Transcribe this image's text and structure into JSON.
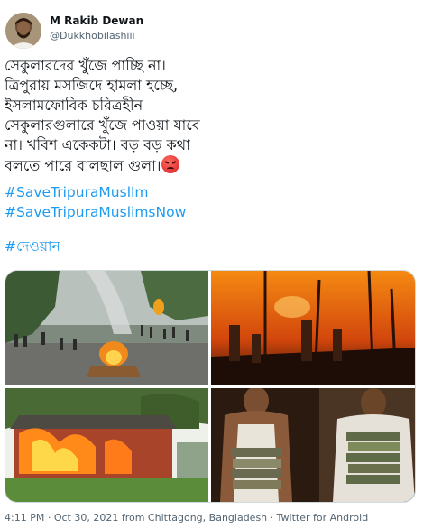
{
  "author": {
    "name": "M Rakib Dewan",
    "handle": "@Dukkhobilashiii"
  },
  "tweet": {
    "lines": [
      "সেকুলারদের খুঁজে পাচ্ছি না।",
      "ত্রিপুরায় মসজিদে হামলা হচ্ছে,",
      "ইসলামফোবিক চরিত্রহীন",
      "সেকুলারগুলারে খুঁজে পাওয়া যাবে",
      "না। খবিশ একেকটা। বড় বড় কথা",
      "বলতে পারে বালছাল গুলা।"
    ],
    "emoji_icon": "angry-face-icon",
    "hashtags": [
      "#SaveTripuraMusllm",
      "#SaveTripuraMuslimsNow",
      "#দেওয়ান"
    ]
  },
  "media": {
    "images": [
      {
        "icon": "crowd-fire-street-photo"
      },
      {
        "icon": "night-fire-rubble-photo"
      },
      {
        "icon": "burning-house-photo"
      },
      {
        "icon": "man-carrying-books-photo"
      }
    ]
  },
  "meta": {
    "time": "4:11 PM",
    "sep1": " · ",
    "date": "Oct 30, 2021 from Chittagong, Bangladesh",
    "sep2": " · ",
    "source": "Twitter for Android"
  },
  "colors": {
    "link": "#1d9bf0",
    "secondary_text": "#536471",
    "border": "#cfd9de"
  }
}
